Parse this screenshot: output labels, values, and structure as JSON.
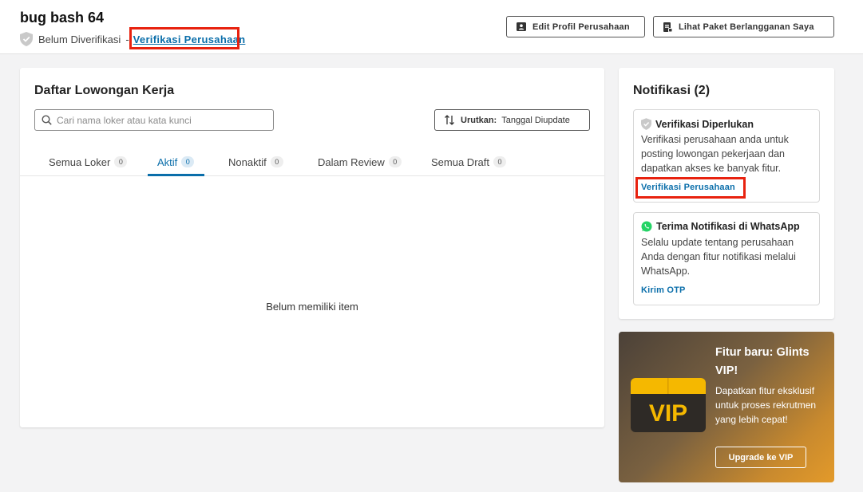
{
  "header": {
    "company_name": "bug bash 64",
    "verification_status": "Belum Diverifikasi",
    "separator": "-",
    "verify_link": "Verifikasi Perusahaan",
    "edit_profile_button": "Edit Profil Perusahaan",
    "subscription_button": "Lihat Paket Berlangganan Saya"
  },
  "jobs": {
    "title": "Daftar Lowongan Kerja",
    "search_placeholder": "Cari nama loker atau kata kunci",
    "sort_label": "Urutkan:",
    "sort_value": "Tanggal Diupdate",
    "tabs": [
      {
        "label": "Semua Loker",
        "count": "0"
      },
      {
        "label": "Aktif",
        "count": "0",
        "active": true
      },
      {
        "label": "Nonaktif",
        "count": "0"
      },
      {
        "label": "Dalam Review",
        "count": "0"
      },
      {
        "label": "Semua Draft",
        "count": "0"
      }
    ],
    "empty_text": "Belum memiliki item"
  },
  "notifications": {
    "title": "Notifikasi (2)",
    "items": [
      {
        "icon": "shield-icon",
        "title": "Verifikasi Diperlukan",
        "body": "Verifikasi perusahaan anda untuk posting lowongan pekerjaan dan dapatkan akses ke banyak fitur.",
        "link": "Verifikasi Perusahaan"
      },
      {
        "icon": "whatsapp-icon",
        "title": "Terima Notifikasi di WhatsApp",
        "body": "Selalu update tentang perusahaan Anda dengan fitur notifikasi melalui WhatsApp.",
        "link": "Kirim OTP"
      }
    ]
  },
  "vip": {
    "title": "Fitur baru: Glints VIP!",
    "description": "Dapatkan fitur eksklusif untuk proses rekrutmen yang lebih cepat!",
    "button": "Upgrade ke VIP",
    "icon_text": "VIP"
  },
  "colors": {
    "link": "#0a6eaa",
    "highlight_box": "#e8220f",
    "whatsapp": "#25d366",
    "vip_gold": "#f5b800"
  }
}
